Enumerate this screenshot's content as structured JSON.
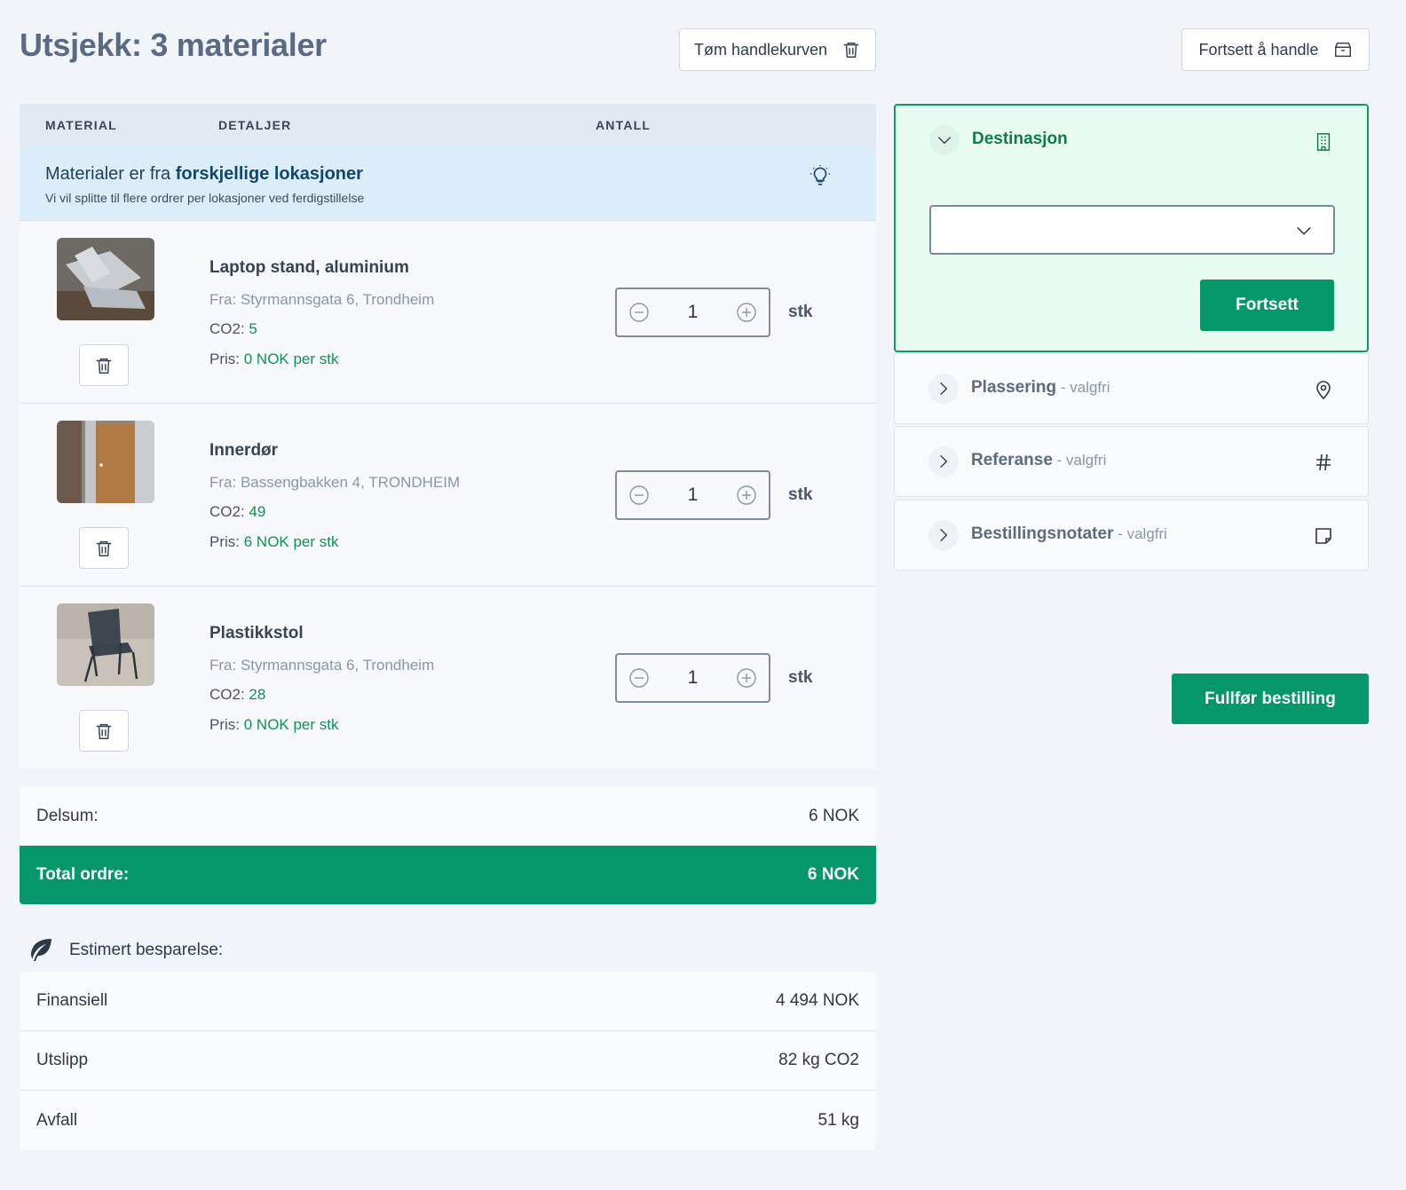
{
  "header": {
    "title": "Utsjekk: 3 materialer",
    "clear_cart_label": "Tøm handlekurven",
    "continue_shopping_label": "Fortsett å handle"
  },
  "table": {
    "columns": [
      "MATERIAL",
      "DETALJER",
      "ANTALL"
    ],
    "notice": {
      "prefix": "Materialer er fra ",
      "highlight": "forskjellige lokasjoner",
      "subtitle": "Vi vil splitte til flere ordrer per lokasjoner ved ferdigstillelse"
    },
    "items": [
      {
        "name": "Laptop stand, aluminium",
        "from": "Fra: Styrmannsgata 6, Trondheim",
        "co2_label": "CO2: ",
        "co2_value": "5",
        "price_label": "Pris: ",
        "price_value": "0 NOK per stk",
        "quantity": "1",
        "unit": "stk"
      },
      {
        "name": "Innerdør",
        "from": "Fra: Bassengbakken 4, TRONDHEIM",
        "co2_label": "CO2: ",
        "co2_value": "49",
        "price_label": "Pris: ",
        "price_value": "6 NOK per stk",
        "quantity": "1",
        "unit": "stk"
      },
      {
        "name": "Plastikkstol",
        "from": "Fra: Styrmannsgata 6, Trondheim",
        "co2_label": "CO2: ",
        "co2_value": "28",
        "price_label": "Pris: ",
        "price_value": "0 NOK per stk",
        "quantity": "1",
        "unit": "stk"
      }
    ]
  },
  "totals": {
    "subtotal_label": "Delsum:",
    "subtotal_value": "6 NOK",
    "total_label": "Total ordre:",
    "total_value": "6 NOK"
  },
  "savings": {
    "title": "Estimert besparelse:",
    "rows": [
      {
        "label": "Finansiell",
        "value": "4 494 NOK"
      },
      {
        "label": "Utslipp",
        "value": "82 kg CO2"
      },
      {
        "label": "Avfall",
        "value": "51 kg"
      }
    ]
  },
  "panel": {
    "destination": {
      "label": "Destinasjon",
      "select_value": "",
      "continue_label": "Fortsett"
    },
    "sections": [
      {
        "label": "Plassering",
        "optional": " - valgfri",
        "icon": "map-pin-icon"
      },
      {
        "label": "Referanse",
        "optional": " - valgfri",
        "icon": "hash-icon"
      },
      {
        "label": "Bestillingsnotater",
        "optional": " - valgfri",
        "icon": "note-icon"
      }
    ],
    "finish_label": "Fullfør bestilling"
  },
  "colors": {
    "primary_green": "#059669",
    "title_slate": "#5b6a83",
    "notice_bg": "#dcedfa"
  }
}
